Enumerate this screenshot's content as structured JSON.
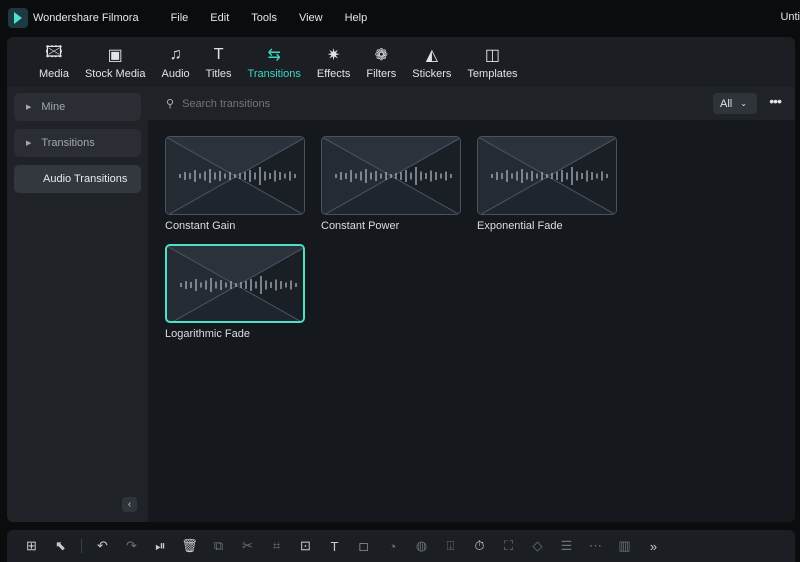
{
  "app": {
    "title": "Wondershare Filmora",
    "project": "Unti"
  },
  "menu": [
    "File",
    "Edit",
    "Tools",
    "View",
    "Help"
  ],
  "toolbar": [
    {
      "label": "Media",
      "icon": "media-icon",
      "glyph": "🖾"
    },
    {
      "label": "Stock Media",
      "icon": "stock-media-icon",
      "glyph": "▣"
    },
    {
      "label": "Audio",
      "icon": "audio-icon",
      "glyph": "♫"
    },
    {
      "label": "Titles",
      "icon": "titles-icon",
      "glyph": "T"
    },
    {
      "label": "Transitions",
      "icon": "transitions-icon",
      "glyph": "⇆",
      "active": true
    },
    {
      "label": "Effects",
      "icon": "effects-icon",
      "glyph": "✷"
    },
    {
      "label": "Filters",
      "icon": "filters-icon",
      "glyph": "❁"
    },
    {
      "label": "Stickers",
      "icon": "stickers-icon",
      "glyph": "◭"
    },
    {
      "label": "Templates",
      "icon": "templates-icon",
      "glyph": "◫"
    }
  ],
  "sidebar": {
    "items": [
      {
        "label": "Mine"
      },
      {
        "label": "Transitions"
      },
      {
        "label": "Audio Transitions",
        "selected": true
      }
    ]
  },
  "search": {
    "placeholder": "Search transitions",
    "filter": "All"
  },
  "transitions": [
    {
      "label": "Constant Gain"
    },
    {
      "label": "Constant Power"
    },
    {
      "label": "Exponential Fade"
    },
    {
      "label": "Logarithmic Fade",
      "selected": true
    }
  ],
  "accent": "#3fd6c0"
}
